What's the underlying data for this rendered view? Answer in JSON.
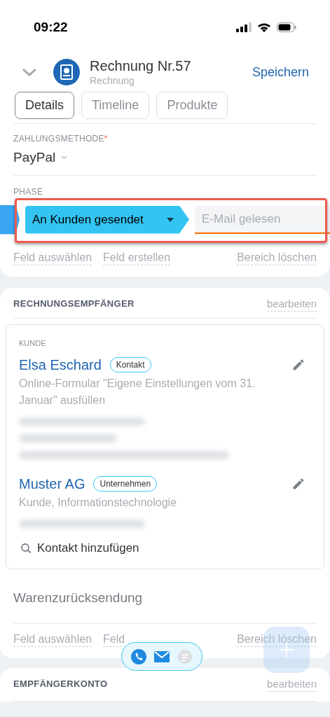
{
  "status_bar": {
    "time": "09:22"
  },
  "header": {
    "title": "Rechnung Nr.57",
    "subtitle": "Rechnung",
    "action": "Speichern"
  },
  "tabs": [
    {
      "label": "Details",
      "selected": true
    },
    {
      "label": "Timeline",
      "selected": false
    },
    {
      "label": "Produkte",
      "selected": false
    }
  ],
  "details": {
    "payment": {
      "label": "ZAHLUNGSMETHODE",
      "required_mark": "*",
      "value": "PayPal"
    },
    "phase": {
      "label": "PHASE",
      "stages": [
        {
          "label": "An Kunden gesendet",
          "selected": true
        },
        {
          "label": "E-Mail gelesen",
          "selected": false
        }
      ],
      "highlighted": true
    },
    "actions": [
      "Feld auswählen",
      "Feld erstellen",
      "Bereich löschen"
    ]
  },
  "recipients": {
    "title": "RECHNUNGSEMPFÄNGER",
    "edit": "bearbeiten",
    "section_label": "KUNDE",
    "entries": [
      {
        "name": "Elsa Eschard",
        "tag": "Kontakt",
        "description": "Online-Formular \"Eigene Einstellungen vom 31. Januar\" ausfüllen"
      },
      {
        "name": "Muster AG",
        "tag": "Unternehmen",
        "description": "Kunde, Informationstechnologie"
      }
    ],
    "add_contact": "Kontakt hinzufügen"
  },
  "returns": {
    "title": "Warenzurücksendung",
    "actions": [
      "Feld auswählen",
      "Feld",
      "Bereich löschen"
    ]
  },
  "account": {
    "title": "EMPFÄNGERKONTO",
    "edit": "bearbeiten"
  }
}
